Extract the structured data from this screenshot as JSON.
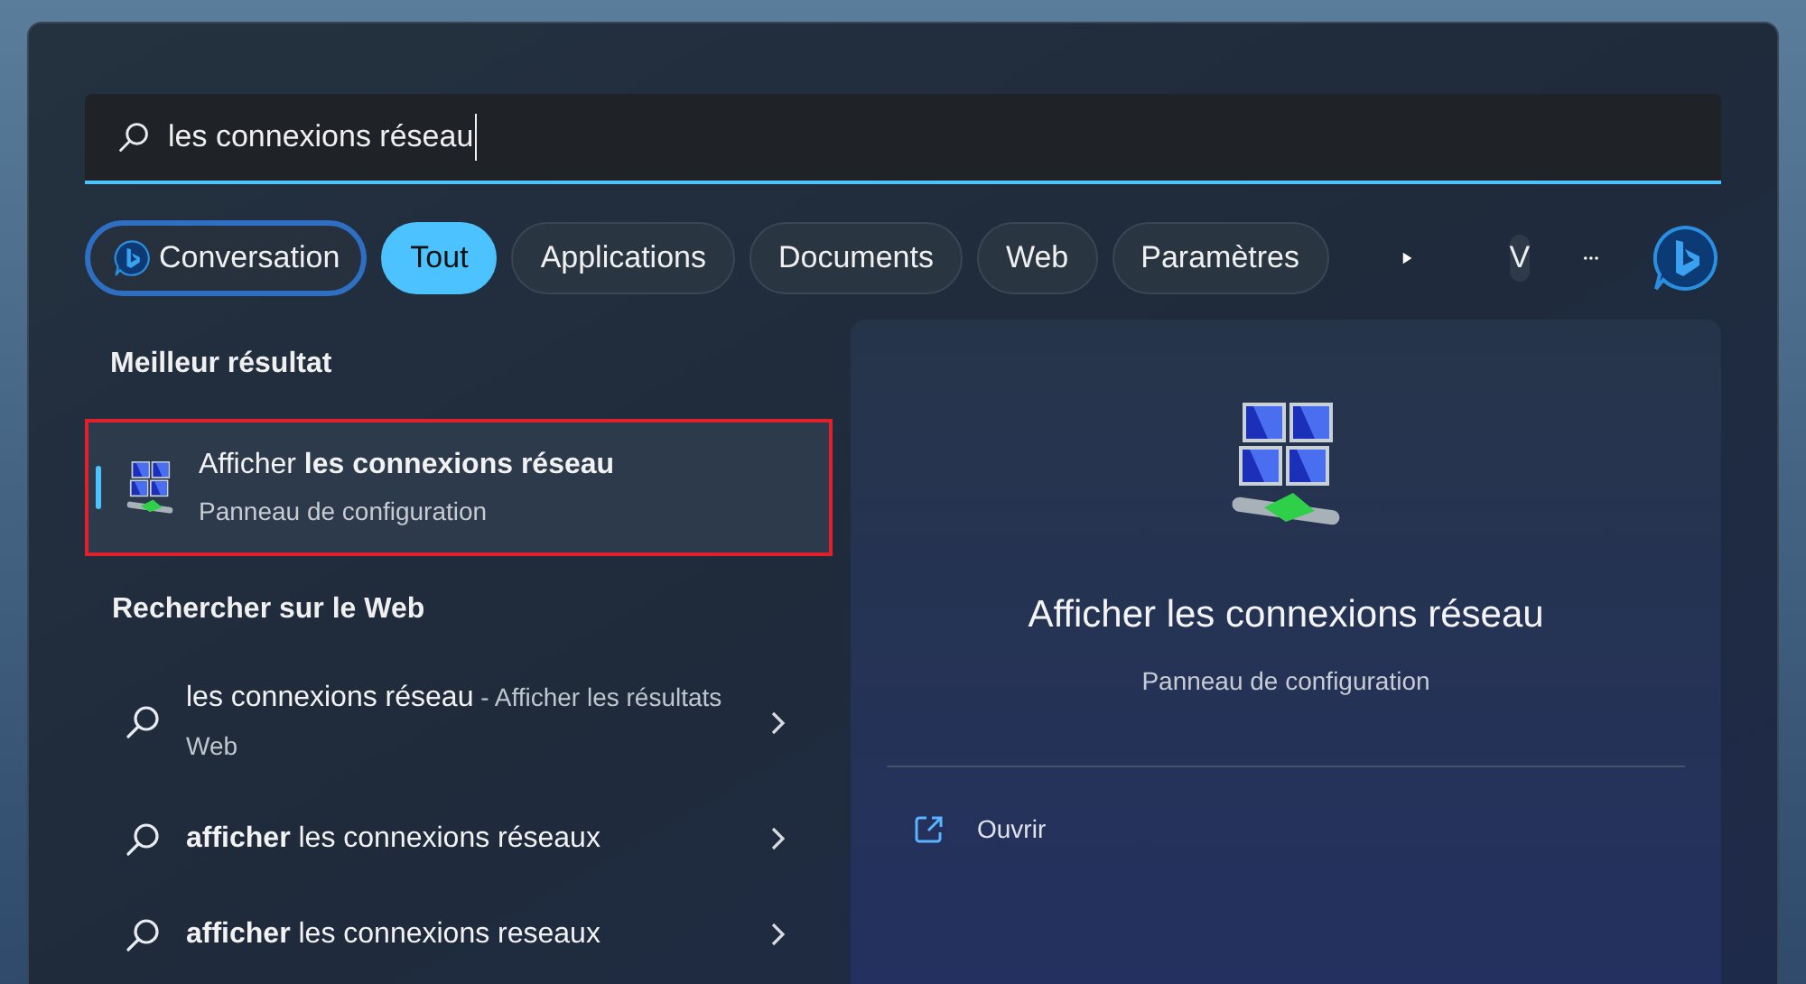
{
  "search": {
    "value": "les connexions réseau"
  },
  "filters": [
    {
      "kind": "bing",
      "label": "Conversation",
      "selected": false
    },
    {
      "kind": "chip",
      "label": "Tout",
      "selected": true
    },
    {
      "kind": "chip",
      "label": "Applications",
      "selected": false
    },
    {
      "kind": "chip",
      "label": "Documents",
      "selected": false
    },
    {
      "kind": "chip",
      "label": "Web",
      "selected": false
    },
    {
      "kind": "chip",
      "label": "Paramètres",
      "selected": false
    }
  ],
  "account": {
    "initial": "V"
  },
  "best_result": {
    "heading": "Meilleur résultat",
    "title": "Afficher **les connexions réseau**",
    "subtitle": "Panneau de configuration",
    "selected": true,
    "highlighted": true
  },
  "web_search": {
    "heading": "Rechercher sur le Web",
    "items": [
      {
        "text": "les connexions réseau",
        "hint": "- Afficher les résultats Web"
      },
      {
        "text": "**afficher** les connexions réseaux"
      },
      {
        "text": "**afficher** les connexions reseaux"
      }
    ]
  },
  "preview": {
    "title": "Afficher les connexions réseau",
    "subtitle": "Panneau de configuration",
    "actions": [
      {
        "label": "Ouvrir"
      }
    ]
  }
}
